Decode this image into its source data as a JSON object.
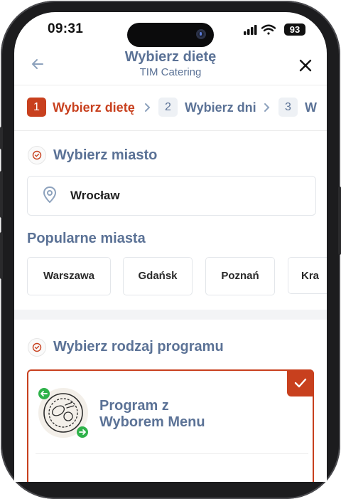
{
  "status_bar": {
    "time": "09:31",
    "battery": "93"
  },
  "header": {
    "title": "Wybierz dietę",
    "subtitle": "TIM Catering"
  },
  "steps": [
    {
      "number": "1",
      "label": "Wybierz dietę",
      "active": true
    },
    {
      "number": "2",
      "label": "Wybierz dni",
      "active": false
    },
    {
      "number": "3",
      "label": "W",
      "active": false
    }
  ],
  "city_section": {
    "title": "Wybierz miasto",
    "selected_city": "Wrocław",
    "popular_title": "Popularne miasta",
    "popular_cities": [
      "Warszawa",
      "Gdańsk",
      "Poznań",
      "Kra"
    ]
  },
  "program_section": {
    "title": "Wybierz rodzaj programu",
    "selected_program": "Program z\nWyborem Menu"
  },
  "colors": {
    "accent": "#c8401e",
    "heading": "#5b7296",
    "step_inactive_bg": "#eef1f5",
    "green": "#2fb24a"
  }
}
